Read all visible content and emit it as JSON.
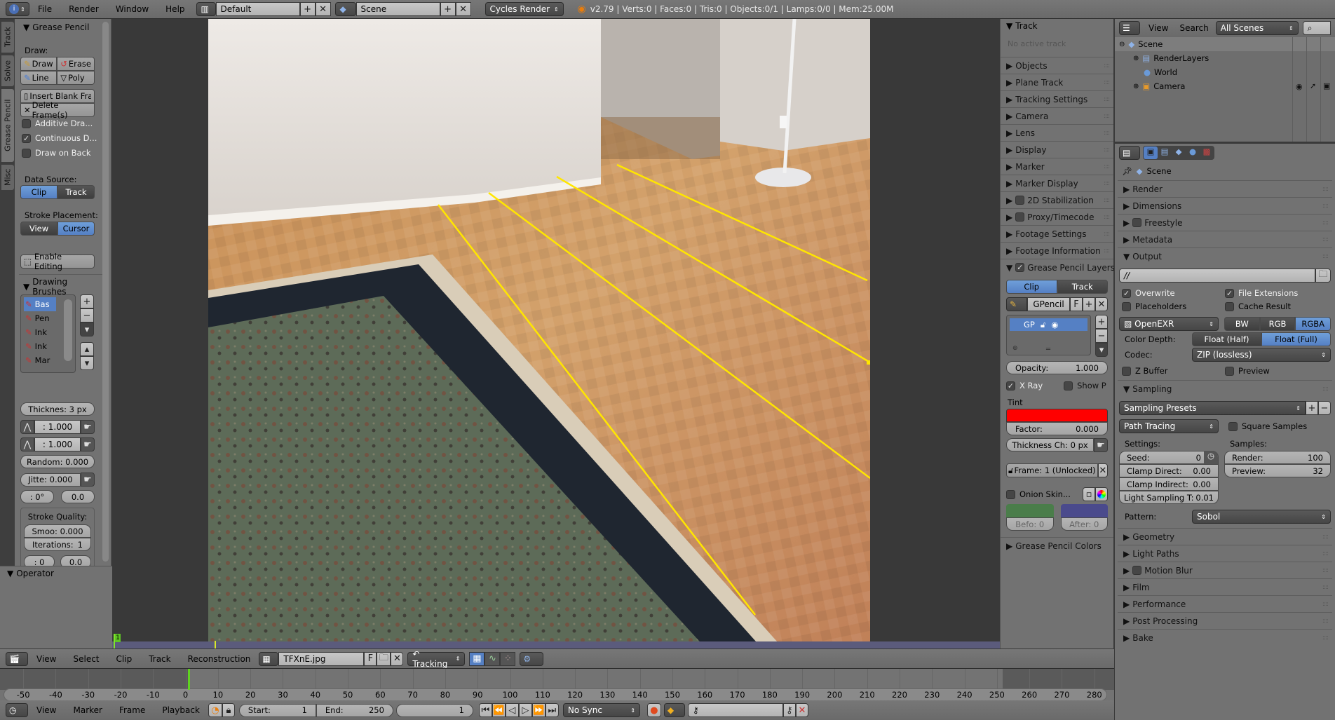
{
  "topbar": {
    "menus": [
      "File",
      "Render",
      "Window",
      "Help"
    ],
    "screen_layout": "Default",
    "scene": "Scene",
    "render_engine": "Cycles Render",
    "stats": "v2.79 | Verts:0 | Faces:0 | Tris:0 | Objects:0/1 | Lamps:0/0 | Mem:25.00M"
  },
  "tool_tabs": [
    "Track",
    "Solve",
    "Grease Pencil",
    "Misc"
  ],
  "tool_shelf": {
    "panel_title": "Grease Pencil",
    "draw_label": "Draw:",
    "draw_buttons": [
      "Draw",
      "Erase",
      "Line",
      "Poly"
    ],
    "insert_blank": "Insert Blank Fra...",
    "delete_frames": "Delete Frame(s)",
    "checkboxes": [
      {
        "label": "Additive Dra...",
        "checked": false
      },
      {
        "label": "Continuous D...",
        "checked": true
      },
      {
        "label": "Draw on Back",
        "checked": false
      }
    ],
    "data_source_label": "Data Source:",
    "data_source": [
      "Clip",
      "Track"
    ],
    "data_source_active": "Clip",
    "stroke_placement_label": "Stroke Placement:",
    "stroke_placement": [
      "View",
      "Cursor"
    ],
    "stroke_placement_active": "Cursor",
    "enable_editing": "Enable Editing",
    "brushes_title": "Drawing Brushes",
    "brushes": [
      "Bas",
      "Pen",
      "Ink",
      "Ink",
      "Mar"
    ],
    "active_brush": "Bas",
    "thickness": "Thicknes: 3 px",
    "strength1": ": 1.000",
    "strength2": ": 1.000",
    "random": "Random: 0.000",
    "jitter": "Jitte: 0.000",
    "angle": ": 0°",
    "angle_factor": "0.0",
    "stroke_quality_label": "Stroke Quality:",
    "smooth": "Smoo: 0.000",
    "iterations": "Iterations:",
    "iterations_value": "1",
    "subdivide": ": 0",
    "subdivide_random": "0.0",
    "operator_title": "Operator"
  },
  "viewport": {
    "frame_marker": "1"
  },
  "npanel": {
    "track_title": "Track",
    "no_active_track": "No active track",
    "sections": [
      {
        "label": "Objects",
        "checkbox": false
      },
      {
        "label": "Plane Track",
        "checkbox": false
      },
      {
        "label": "Tracking Settings",
        "checkbox": false
      },
      {
        "label": "Camera",
        "checkbox": false
      },
      {
        "label": "Lens",
        "checkbox": false
      },
      {
        "label": "Display",
        "checkbox": false
      },
      {
        "label": "Marker",
        "checkbox": false
      },
      {
        "label": "Marker Display",
        "checkbox": false
      },
      {
        "label": "2D Stabilization",
        "checkbox": true
      },
      {
        "label": "Proxy/Timecode",
        "checkbox": true
      },
      {
        "label": "Footage Settings",
        "checkbox": false
      },
      {
        "label": "Footage Information",
        "checkbox": false
      }
    ],
    "gp_layers_title": "Grease Pencil Layers",
    "gp_source": [
      "Clip",
      "Track"
    ],
    "gp_datablock": "GPencil",
    "gp_fake": "F",
    "layer_name": "GP",
    "opacity_label": "Opacity:",
    "opacity_value": "1.000",
    "xray": "X Ray",
    "show_points": "Show P",
    "tint_label": "Tint",
    "tint_color": "#ff0000",
    "factor_label": "Factor:",
    "factor_value": "0.000",
    "thickness_change": "Thickness Ch: 0 px",
    "frame_lock": "Frame: 1 (Unlocked)",
    "onion_skin": "Onion Skin...",
    "before": "Befo: 0",
    "after": "After: 0",
    "before_color": "#4a7d4a",
    "after_color": "#4a4a8c",
    "gp_colors_title": "Grease Pencil Colors"
  },
  "outliner": {
    "view": "View",
    "search": "Search",
    "filter": "All Scenes",
    "items": [
      {
        "label": "Scene",
        "level": 0
      },
      {
        "label": "RenderLayers",
        "level": 1
      },
      {
        "label": "World",
        "level": 1
      },
      {
        "label": "Camera",
        "level": 1
      }
    ]
  },
  "properties": {
    "context": "Scene",
    "sections_top": [
      "Render",
      "Dimensions",
      "Freestyle",
      "Metadata"
    ],
    "output_title": "Output",
    "output_path": "//",
    "overwrite": "Overwrite",
    "file_extensions": "File Extensions",
    "placeholders": "Placeholders",
    "cache_result": "Cache Result",
    "file_format": "OpenEXR",
    "color_modes": [
      "BW",
      "RGB",
      "RGBA"
    ],
    "color_mode_active": "RGBA",
    "color_depth_label": "Color Depth:",
    "color_depths": [
      "Float (Half)",
      "Float (Full)"
    ],
    "color_depth_active": "Float (Full)",
    "codec_label": "Codec:",
    "codec": "ZIP (lossless)",
    "zbuffer": "Z Buffer",
    "preview": "Preview",
    "sampling_title": "Sampling",
    "sampling_presets": "Sampling Presets",
    "integrator": "Path Tracing",
    "square_samples": "Square Samples",
    "settings_label": "Settings:",
    "samples_label": "Samples:",
    "seed_label": "Seed:",
    "seed_value": "0",
    "clamp_direct_label": "Clamp Direct:",
    "clamp_direct_value": "0.00",
    "clamp_indirect_label": "Clamp Indirect:",
    "clamp_indirect_value": "0.00",
    "light_sampling_label": "Light Sampling T:",
    "light_sampling_value": "0.01",
    "render_label": "Render:",
    "render_value": "100",
    "preview_label": "Preview:",
    "preview_value": "32",
    "pattern_label": "Pattern:",
    "pattern": "Sobol",
    "sections_bottom": [
      "Geometry",
      "Light Paths",
      "Motion Blur",
      "Film",
      "Performance",
      "Post Processing",
      "Bake"
    ]
  },
  "clip_header": {
    "menus": [
      "View",
      "Select",
      "Clip",
      "Track",
      "Reconstruction"
    ],
    "clip_name": "TFXnE.jpg",
    "fake": "F",
    "mode": "Tracking"
  },
  "timeline": {
    "ticks": [
      -50,
      -40,
      -30,
      -20,
      -10,
      0,
      10,
      20,
      30,
      40,
      50,
      60,
      70,
      80,
      90,
      100,
      110,
      120,
      130,
      140,
      150,
      160,
      170,
      180,
      190,
      200,
      210,
      220,
      230,
      240,
      250,
      260,
      270,
      280
    ],
    "current_frame": 1,
    "menus": [
      "View",
      "Marker",
      "Frame",
      "Playback"
    ],
    "start_label": "Start:",
    "start_value": "1",
    "end_label": "End:",
    "end_value": "250",
    "frame_value": "1",
    "sync": "No Sync"
  }
}
